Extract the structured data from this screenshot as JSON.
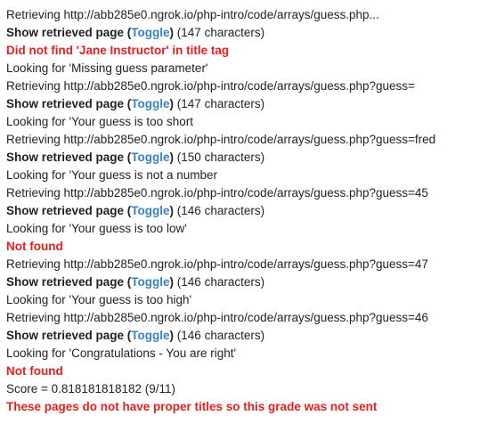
{
  "colors": {
    "text": "#222222",
    "error": "#e3211c",
    "link": "#3b82c4"
  },
  "log": [
    {
      "type": "text",
      "name": "retrieving-line",
      "text": "Retrieving http://abb285e0.ngrok.io/php-intro/code/arrays/guess.php..."
    },
    {
      "type": "show",
      "label": "Show retrieved page",
      "open": " (",
      "toggle": "Toggle",
      "close": ")",
      "count": " (147 characters)"
    },
    {
      "type": "error",
      "name": "error-message",
      "text": "Did not find 'Jane Instructor' in title tag"
    },
    {
      "type": "text",
      "name": "looking-for-line",
      "text": "Looking for 'Missing guess parameter'"
    },
    {
      "type": "text",
      "name": "retrieving-line",
      "text": "Retrieving http://abb285e0.ngrok.io/php-intro/code/arrays/guess.php?guess="
    },
    {
      "type": "show",
      "label": "Show retrieved page",
      "open": " (",
      "toggle": "Toggle",
      "close": ")",
      "count": " (147 characters)"
    },
    {
      "type": "text",
      "name": "looking-for-line",
      "text": "Looking for 'Your guess is too short"
    },
    {
      "type": "text",
      "name": "retrieving-line",
      "text": "Retrieving http://abb285e0.ngrok.io/php-intro/code/arrays/guess.php?guess=fred"
    },
    {
      "type": "show",
      "label": "Show retrieved page",
      "open": " (",
      "toggle": "Toggle",
      "close": ")",
      "count": " (150 characters)"
    },
    {
      "type": "text",
      "name": "looking-for-line",
      "text": "Looking for 'Your guess is not a number"
    },
    {
      "type": "text",
      "name": "retrieving-line",
      "text": "Retrieving http://abb285e0.ngrok.io/php-intro/code/arrays/guess.php?guess=45"
    },
    {
      "type": "show",
      "label": "Show retrieved page",
      "open": " (",
      "toggle": "Toggle",
      "close": ")",
      "count": " (146 characters)"
    },
    {
      "type": "text",
      "name": "looking-for-line",
      "text": "Looking for 'Your guess is too low'"
    },
    {
      "type": "error",
      "name": "not-found-message",
      "text": "Not found"
    },
    {
      "type": "text",
      "name": "retrieving-line",
      "text": "Retrieving http://abb285e0.ngrok.io/php-intro/code/arrays/guess.php?guess=47"
    },
    {
      "type": "show",
      "label": "Show retrieved page",
      "open": " (",
      "toggle": "Toggle",
      "close": ")",
      "count": " (146 characters)"
    },
    {
      "type": "text",
      "name": "looking-for-line",
      "text": "Looking for 'Your guess is too high'"
    },
    {
      "type": "text",
      "name": "retrieving-line",
      "text": "Retrieving http://abb285e0.ngrok.io/php-intro/code/arrays/guess.php?guess=46"
    },
    {
      "type": "show",
      "label": "Show retrieved page",
      "open": " (",
      "toggle": "Toggle",
      "close": ")",
      "count": " (146 characters)"
    },
    {
      "type": "text",
      "name": "looking-for-line",
      "text": "Looking for 'Congratulations - You are right'"
    },
    {
      "type": "error",
      "name": "not-found-message",
      "text": "Not found"
    },
    {
      "type": "text",
      "name": "score-line",
      "text": "Score = 0.818181818182 (9/11)"
    },
    {
      "type": "error",
      "name": "grade-not-sent-message",
      "text": "These pages do not have proper titles so this grade was not sent"
    }
  ]
}
